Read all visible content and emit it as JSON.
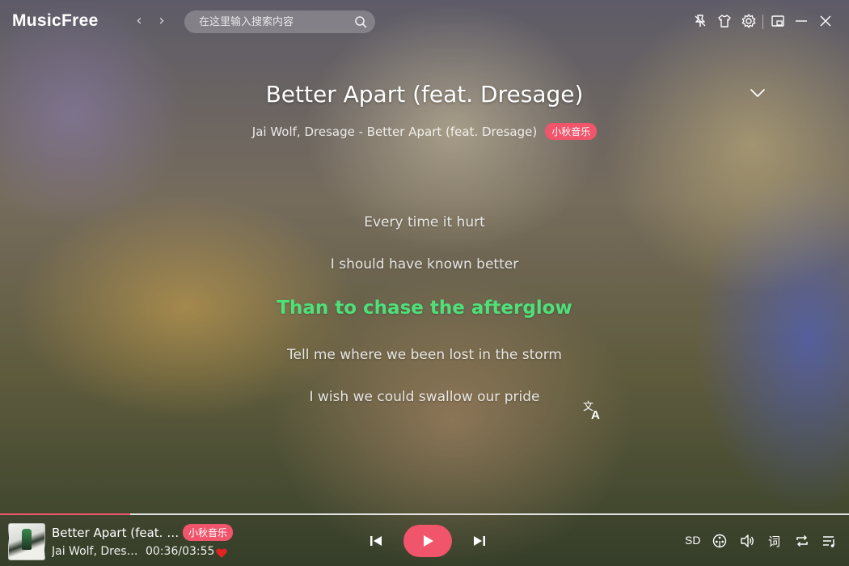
{
  "app": {
    "name": "MusicFree",
    "search_placeholder": "在这里输入搜索内容"
  },
  "toolbar": {
    "icons": [
      "pin-icon",
      "skin-shirt-icon",
      "settings-gear-icon",
      "mini-mode-icon",
      "minimize-icon",
      "close-icon"
    ]
  },
  "song": {
    "title": "Better Apart (feat. Dresage)",
    "subtitle": "Jai Wolf, Dresage - Better Apart (feat. Dresage)",
    "source_badge": "小秋音乐"
  },
  "lyrics": [
    "Every time it hurt",
    "I should have known better",
    "Than to chase the afterglow",
    "Tell me where we been lost in the storm",
    "I wish we could swallow our pride"
  ],
  "current_lyric_index": 2,
  "player": {
    "title": "Better Apart (feat. D...",
    "source_badge": "小秋音乐",
    "artist": "Jai Wolf, Dresa...",
    "time": "00:36/03:55",
    "progress_fraction": 0.153,
    "favorited": true,
    "quality": "SD",
    "lyric_toggle": "词"
  },
  "colors": {
    "accent": "#f0556b",
    "current_lyric": "#4fe07a"
  }
}
